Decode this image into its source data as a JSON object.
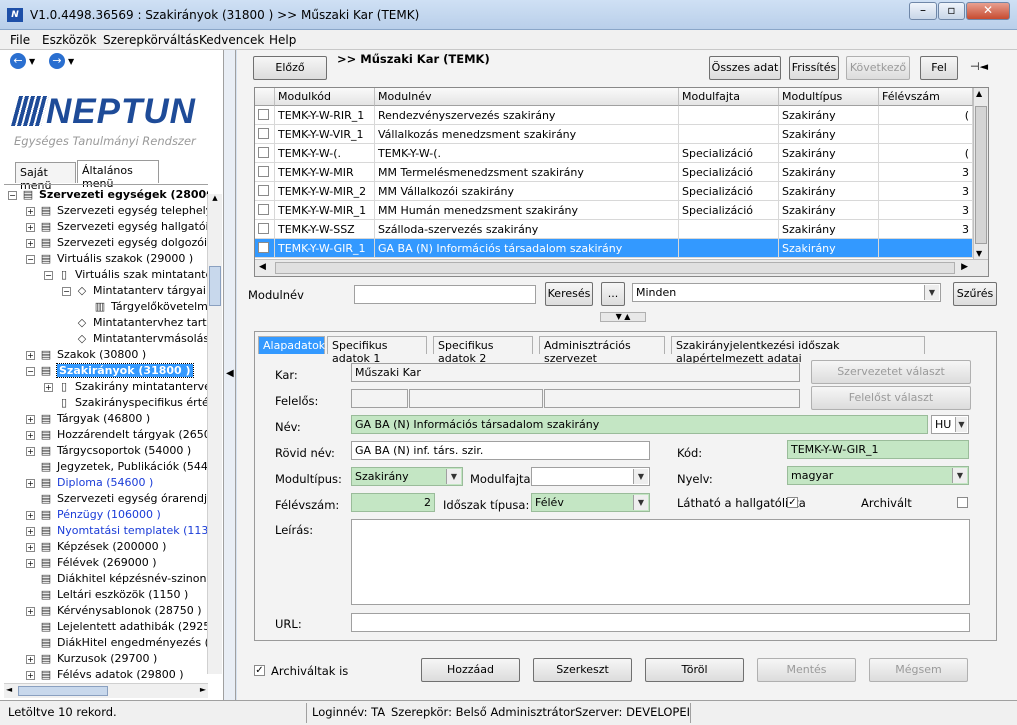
{
  "window": {
    "title": "V1.0.4498.36569 : Szakirányok (31800  )  >> Műszaki Kar (TEMK)",
    "app_icon": "N"
  },
  "menu": [
    "File",
    "Eszközök",
    "Szerepkörváltás",
    "Kedvencek",
    "Help"
  ],
  "sidebar": {
    "logo": "NEPTUN",
    "logo_subtitle": "Egységes Tanulmányi Rendszer",
    "tabs": [
      "Saját menü",
      "Általános menü"
    ],
    "tree": [
      {
        "label": "Szervezeti egységek (28000",
        "level": 0,
        "exp": "−",
        "bold": true
      },
      {
        "label": "Szervezeti egység telephelyei",
        "level": 1,
        "exp": "+"
      },
      {
        "label": "Szervezeti egység hallgatói (2",
        "level": 1,
        "exp": "+"
      },
      {
        "label": "Szervezeti egység dolgozói (2",
        "level": 1,
        "exp": "+"
      },
      {
        "label": "Virtuális szakok (29000  )",
        "level": 1,
        "exp": "−"
      },
      {
        "label": "Virtuális szak mintatanterv",
        "level": 2,
        "exp": "−",
        "icon": "doc"
      },
      {
        "label": "Mintatanterv tárgyai (2",
        "level": 3,
        "exp": "−",
        "icon": "diamond"
      },
      {
        "label": "Tárgyelőkövetelm",
        "level": 4,
        "exp": "",
        "icon": "book"
      },
      {
        "label": "Mintatantervhez tarto:",
        "level": 3,
        "exp": "",
        "icon": "diamond"
      },
      {
        "label": "Mintatantervmásolás",
        "level": 3,
        "exp": "",
        "icon": "diamond"
      },
      {
        "label": "Szakok (30800  )",
        "level": 1,
        "exp": "+"
      },
      {
        "label": "Szakirányok (31800  )",
        "level": 1,
        "exp": "−",
        "selected": true
      },
      {
        "label": "Szakirány mintatantervei (",
        "level": 2,
        "exp": "+",
        "icon": "doc"
      },
      {
        "label": "Szakirányspecifikus érték",
        "level": 2,
        "exp": "",
        "icon": "doc"
      },
      {
        "label": "Tárgyak (46800  )",
        "level": 1,
        "exp": "+"
      },
      {
        "label": "Hozzárendelt tárgyak (2650",
        "level": 1,
        "exp": "+"
      },
      {
        "label": "Tárgycsoportok (54000  )",
        "level": 1,
        "exp": "+"
      },
      {
        "label": "Jegyzetek, Publikációk (5440",
        "level": 1,
        "exp": ""
      },
      {
        "label": "Diploma (54600  )",
        "level": 1,
        "exp": "+",
        "blue": true
      },
      {
        "label": "Szervezeti egység órarendje (",
        "level": 1,
        "exp": ""
      },
      {
        "label": "Pénzügy (106000  )",
        "level": 1,
        "exp": "+",
        "blue": true
      },
      {
        "label": "Nyomtatási templatek (11300(",
        "level": 1,
        "exp": "+",
        "blue": true
      },
      {
        "label": "Képzések (200000  )",
        "level": 1,
        "exp": "+"
      },
      {
        "label": "Félévek (269000  )",
        "level": 1,
        "exp": "+"
      },
      {
        "label": "Diákhitel képzésnév-szinonim",
        "level": 1,
        "exp": ""
      },
      {
        "label": "Leltári eszközök (1150  )",
        "level": 1,
        "exp": ""
      },
      {
        "label": "Kérvénysablonok (28750  )",
        "level": 1,
        "exp": "+"
      },
      {
        "label": "Lejelentett adathibák (29250",
        "level": 1,
        "exp": ""
      },
      {
        "label": "DiákHitel engedményezés (2!",
        "level": 1,
        "exp": ""
      },
      {
        "label": "Kurzusok (29700  )",
        "level": 1,
        "exp": "+"
      },
      {
        "label": "Félévs adatok (29800  )",
        "level": 1,
        "exp": "+"
      }
    ]
  },
  "toolbar": {
    "prev": "Előző",
    "breadcrumb": ">> Műszaki Kar (TEMK)",
    "all_data": "Összes adat",
    "refresh": "Frissítés",
    "next": "Következő",
    "up": "Fel",
    "pin_icon": "⊣◄"
  },
  "grid": {
    "columns": [
      "Modulkód",
      "Modulnév",
      "Modulfajta",
      "Modultípus",
      "Félévszám"
    ],
    "rows": [
      [
        "TEMK-Y-W-RIR_1",
        "Rendezvényszervezés szakirány",
        "",
        "Szakirány",
        "("
      ],
      [
        "TEMK-Y-W-VIR_1",
        "Vállalkozás menedzsment szakirány",
        "",
        "Szakirány",
        ""
      ],
      [
        "TEMK-Y-W-(.",
        "TEMK-Y-W-(.",
        "Specializáció",
        "Szakirány",
        "("
      ],
      [
        "TEMK-Y-W-MIR",
        "MM Termelésmenedzsment szakirány",
        "Specializáció",
        "Szakirány",
        "3"
      ],
      [
        "TEMK-Y-W-MIR_2",
        "MM Vállalkozói szakirány",
        "Specializáció",
        "Szakirány",
        "3"
      ],
      [
        "TEMK-Y-W-MIR_1",
        "MM Humán menedzsment szakirány",
        "Specializáció",
        "Szakirány",
        "3"
      ],
      [
        "TEMK-Y-W-SSZ",
        "Szálloda-szervezés szakirány",
        "",
        "Szakirány",
        "3"
      ],
      [
        "TEMK-Y-W-GIR_1",
        "GA BA (N) Információs társadalom szakirány",
        "",
        "Szakirány",
        ""
      ]
    ],
    "selected_index": 7
  },
  "search": {
    "label": "Modulnév",
    "value": "",
    "search_btn": "Keresés",
    "more_btn": "...",
    "filter_value": "Minden",
    "filter_btn": "Szűrés"
  },
  "detail": {
    "tabs": [
      "Alapadatok",
      "Specifikus adatok 1",
      "Specifikus adatok 2",
      "Adminisztrációs szervezet",
      "Szakirányjelentkezési időszak alapértelmezett adatai"
    ],
    "kar_label": "Kar:",
    "kar_value": "Műszaki Kar",
    "felelos_label": "Felelős:",
    "szervezet_btn": "Szervezetet választ",
    "felelos_btn": "Felelőst választ",
    "nev_label": "Név:",
    "nev_value": "GA BA (N) Információs társadalom szakirány",
    "lang": "HU",
    "rovid_label": "Rövid név:",
    "rovid_value": "GA BA (N) inf. társ. szir.",
    "kod_label": "Kód:",
    "kod_value": "TEMK-Y-W-GIR_1",
    "modultipus_label": "Modultípus:",
    "modultipus_value": "Szakirány",
    "modulfajta_label": "Modulfajta:",
    "modulfajta_value": "",
    "nyelv_label": "Nyelv:",
    "nyelv_value": "magyar",
    "felevszam_label": "Félévszám:",
    "felevszam_value": "2",
    "idoszak_label": "Időszak típusa:",
    "idoszak_value": "Félév",
    "lathato_label": "Látható a hallgatólista",
    "lathato_checked": true,
    "archivalt_label": "Archivált",
    "archivalt_checked": false,
    "leiras_label": "Leírás:",
    "url_label": "URL:"
  },
  "actions": {
    "show_archived": "Archiváltak is",
    "show_archived_checked": true,
    "add": "Hozzáad",
    "edit": "Szerkeszt",
    "delete": "Töröl",
    "save": "Mentés",
    "cancel": "Mégsem"
  },
  "status": {
    "records": "Letöltve 10 rekord.",
    "login": "Loginnév: TA",
    "role": "Szerepkör: Belső Adminisztrátor",
    "server": "Szerver: DEVELOPEI"
  }
}
